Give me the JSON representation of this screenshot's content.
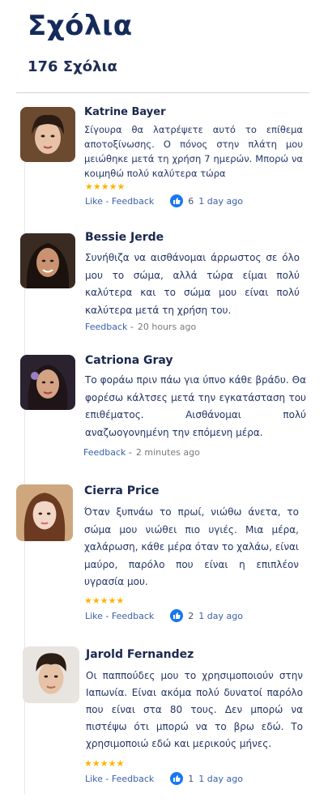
{
  "header": {
    "title": "Σχόλια",
    "count": "176 Σχόλια"
  },
  "comments": [
    {
      "name": "Katrine Bayer",
      "text": "Σίγουρα θα λατρέψετε αυτό το επίθεμα αποτοξίνωσης. Ο πόνος στην πλάτη μου μειώθηκε μετά τη χρήση 7 ημερών. Μπορώ να κοιμηθώ πολύ καλύτερα τώρα",
      "rating": 5,
      "stars": "★★★★★",
      "actions": "Like - Feedback",
      "likes": "6",
      "time": "1 day ago"
    },
    {
      "name": "Bessie Jerde",
      "text": "Συνήθιζα να αισθάνομαι άρρωστος σε όλο μου το σώμα, αλλά τώρα είμαι πολύ καλύτερα και το σώμα μου είναι πολύ καλύτερα μετά τη χρήση του.",
      "actions": "Feedback -",
      "time": "20 hours ago"
    },
    {
      "name": "Catriona Gray",
      "text": "Το φοράω πριν πάω για ύπνο κάθε βράδυ. Θα φορέσω κάλτσες μετά την εγκατάσταση του επιθέματος. Αισθάνομαι πολύ αναζωογονημένη την επόμενη μέρα.",
      "actions": "Feedback -",
      "time": "2 minutes ago"
    },
    {
      "name": "Cierra Price",
      "text": "Όταν ξυπνάω το πρωί, νιώθω άνετα, το σώμα μου νιώθει πιο υγιές. Μια μέρα, χαλάρωση, κάθε μέρα όταν το χαλάω, είναι μαύρο, παρόλο που είναι η επιπλέον υγρασία μου.",
      "rating": 5,
      "stars": "★★★★★",
      "actions": "Like - Feedback",
      "likes": "2",
      "time": "1 day ago"
    },
    {
      "name": "Jarold Fernandez",
      "text": "Οι παππούδες μου το χρησιμοποιούν στην Ιαπωνία. Είναι ακόμα πολύ δυνατοί παρόλο που είναι στα 80 τους. Δεν μπορώ να πιστέψω ότι μπορώ να το βρω εδώ. Το χρησιμοποιώ εδώ και μερικούς μήνες.",
      "rating": 5,
      "stars": "★★★★★",
      "actions": "Like - Feedback",
      "likes": "1",
      "time": "1 day ago"
    }
  ],
  "colors": {
    "title": "#162a5c",
    "link": "#3a5fa8",
    "star": "#ffb300",
    "like": "#1877f2"
  }
}
